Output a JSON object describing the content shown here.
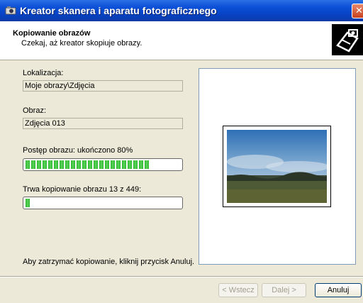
{
  "window": {
    "title": "Kreator skanera i aparatu fotograficznego",
    "close_glyph": "✕"
  },
  "header": {
    "title": "Kopiowanie obrazów",
    "subtitle": "Czekaj, aż kreator skopiuje obrazy."
  },
  "location": {
    "label": "Lokalizacja:",
    "value": "Moje obrazy\\Zdjęcia"
  },
  "image": {
    "label": "Obraz:",
    "value": "Zdjęcia 013"
  },
  "image_progress": {
    "label": "Postęp obrazu: ukończono 80%",
    "percent": 80
  },
  "copy_progress": {
    "label": "Trwa kopiowanie obrazu 13 z 449:",
    "current": 13,
    "total": 449
  },
  "stop_hint": "Aby zatrzymać kopiowanie, kliknij przycisk Anuluj.",
  "buttons": {
    "back": "< Wstecz",
    "next": "Dalej >",
    "cancel": "Anuluj"
  },
  "icons": {
    "app": "scanner-camera-icon",
    "header": "camera-scanner-icon",
    "close": "close-icon"
  },
  "colors": {
    "titlebar": "#0a4fd6",
    "progress": "#2fb62f",
    "dialog_bg": "#ece9d8"
  }
}
